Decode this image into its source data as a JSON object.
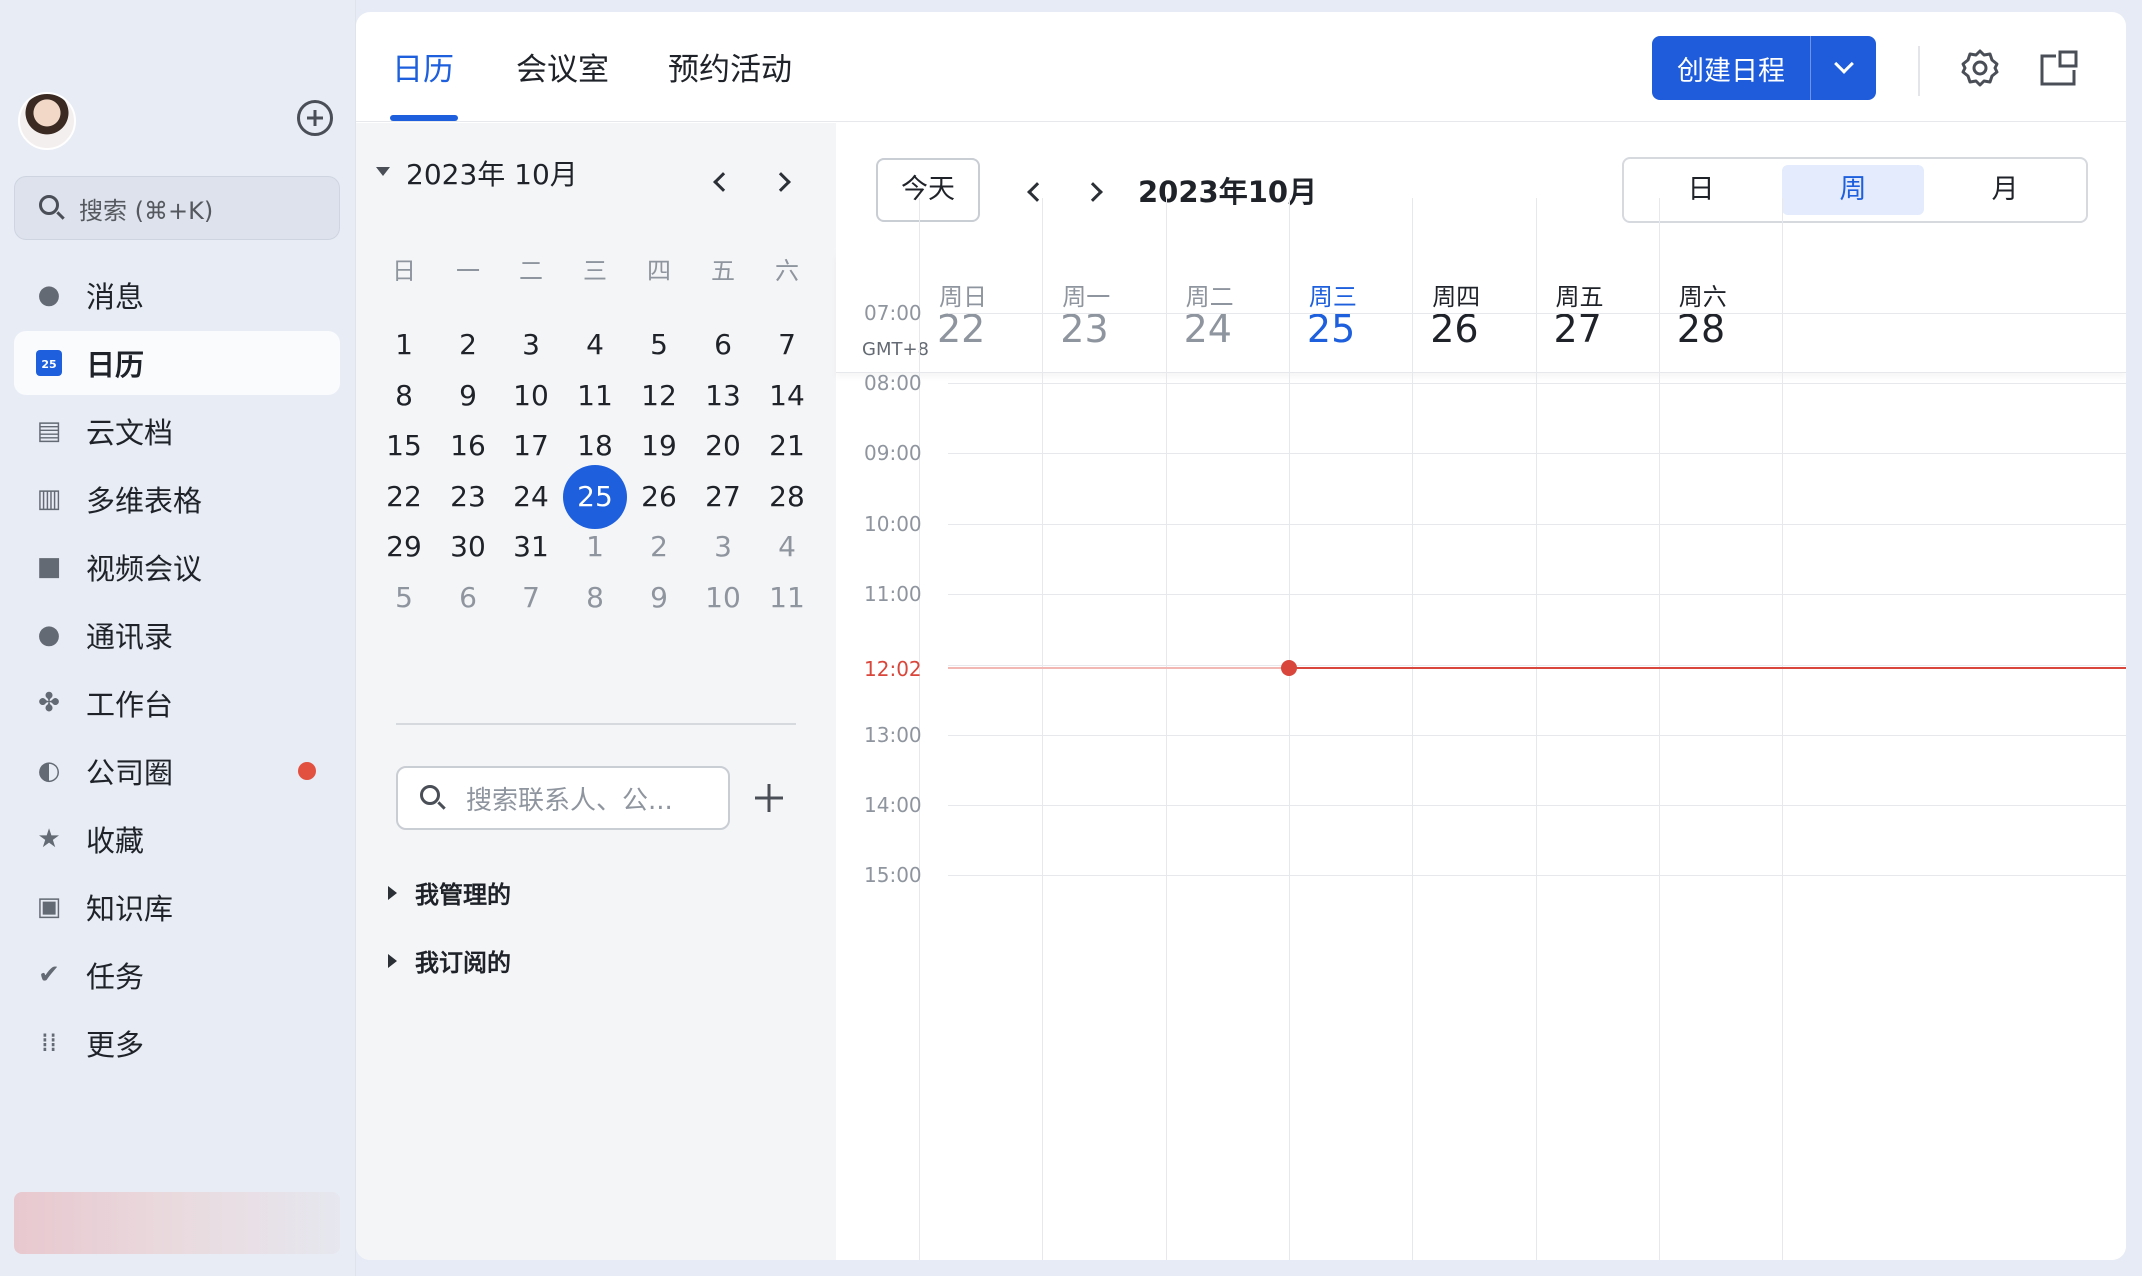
{
  "sidebar": {
    "search_placeholder": "搜索 (⌘+K)",
    "items": [
      {
        "label": "消息",
        "icon": "message-icon"
      },
      {
        "label": "日历",
        "icon": "calendar-icon",
        "active": true
      },
      {
        "label": "云文档",
        "icon": "cloud-doc-icon"
      },
      {
        "label": "多维表格",
        "icon": "table-icon"
      },
      {
        "label": "视频会议",
        "icon": "video-icon"
      },
      {
        "label": "通讯录",
        "icon": "contacts-icon"
      },
      {
        "label": "工作台",
        "icon": "workplace-icon"
      },
      {
        "label": "公司圈",
        "icon": "planet-icon",
        "badge_dot": true
      },
      {
        "label": "收藏",
        "icon": "star-icon"
      },
      {
        "label": "知识库",
        "icon": "knowledge-icon"
      },
      {
        "label": "任务",
        "icon": "task-icon"
      },
      {
        "label": "更多",
        "icon": "more-icon"
      }
    ]
  },
  "header": {
    "tabs": [
      {
        "label": "日历",
        "active": true
      },
      {
        "label": "会议室"
      },
      {
        "label": "预约活动"
      }
    ],
    "create_label": "创建日程"
  },
  "mini_calendar": {
    "title": "2023年 10月",
    "weekdays": [
      "日",
      "一",
      "二",
      "三",
      "四",
      "五",
      "六"
    ],
    "days": [
      [
        "1",
        "2",
        "3",
        "4",
        "5",
        "6",
        "7"
      ],
      [
        "8",
        "9",
        "10",
        "11",
        "12",
        "13",
        "14"
      ],
      [
        "15",
        "16",
        "17",
        "18",
        "19",
        "20",
        "21"
      ],
      [
        "22",
        "23",
        "24",
        "25",
        "26",
        "27",
        "28"
      ],
      [
        "29",
        "30",
        "31",
        "1",
        "2",
        "3",
        "4"
      ],
      [
        "5",
        "6",
        "7",
        "8",
        "9",
        "10",
        "11"
      ]
    ],
    "today": "25",
    "search_placeholder": "搜索联系人、公...",
    "groups": [
      "我管理的",
      "我订阅的"
    ]
  },
  "calendar": {
    "today_label": "今天",
    "title": "2023年10月",
    "views": [
      {
        "label": "日"
      },
      {
        "label": "周",
        "active": true
      },
      {
        "label": "月"
      }
    ],
    "timezone": "GMT+8",
    "days": [
      {
        "weekday": "周日",
        "date": "22",
        "state": "past"
      },
      {
        "weekday": "周一",
        "date": "23",
        "state": "past"
      },
      {
        "weekday": "周二",
        "date": "24",
        "state": "past"
      },
      {
        "weekday": "周三",
        "date": "25",
        "state": "current"
      },
      {
        "weekday": "周四",
        "date": "26",
        "state": "future"
      },
      {
        "weekday": "周五",
        "date": "27",
        "state": "future"
      },
      {
        "weekday": "周六",
        "date": "28",
        "state": "future"
      }
    ],
    "hours": [
      "07:00",
      "08:00",
      "09:00",
      "10:00",
      "11:00",
      "13:00",
      "14:00",
      "15:00"
    ],
    "now_label": "12:02",
    "accent": "#1d5fdd",
    "now_color": "#d9463b"
  }
}
